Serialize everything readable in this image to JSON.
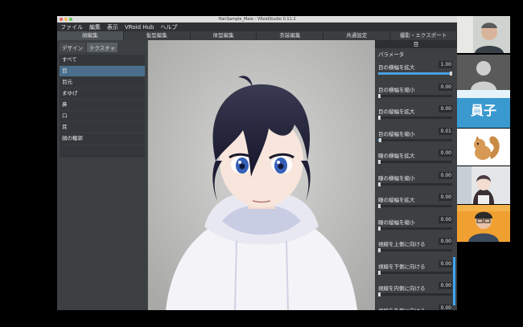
{
  "window": {
    "title": "HairSample_Male - VRoidStudio 0.11.2"
  },
  "menu": [
    "ファイル",
    "編集",
    "表示",
    "VRoid Hub",
    "ヘルプ"
  ],
  "main_tabs": [
    "顔編集",
    "髪型編集",
    "体型編集",
    "衣装編集",
    "共通設定",
    "撮影・エクスポート"
  ],
  "sub_tabs": [
    "デザイン",
    "テクスチャ"
  ],
  "categories": [
    "すべて",
    "目",
    "目元",
    "まゆげ",
    "鼻",
    "口",
    "耳",
    "顔の輪郭"
  ],
  "selected_category": "目",
  "panel": {
    "header": "目",
    "section_title": "パラメータ",
    "params": [
      {
        "label": "目の横幅を拡大",
        "value": "1.00",
        "level": 1.0
      },
      {
        "label": "目の横幅を縮小",
        "value": "0.00",
        "level": 0.0
      },
      {
        "label": "目の縦幅を拡大",
        "value": "0.00",
        "level": 0.0
      },
      {
        "label": "目の縦幅を縮小",
        "value": "0.01",
        "level": 0.01
      },
      {
        "label": "瞳の横幅を拡大",
        "value": "0.00",
        "level": 0.0
      },
      {
        "label": "瞳の横幅を縮小",
        "value": "0.00",
        "level": 0.0
      },
      {
        "label": "瞳の縦幅を拡大",
        "value": "0.00",
        "level": 0.0
      },
      {
        "label": "瞳の縦幅を縮小",
        "value": "0.00",
        "level": 0.0
      },
      {
        "label": "視線を上側に向ける",
        "value": "0.00",
        "level": 0.0
      },
      {
        "label": "視線を下側に向ける",
        "value": "0.00",
        "level": 0.0
      },
      {
        "label": "視線を内側に向ける",
        "value": "0.00",
        "level": 0.0
      },
      {
        "label": "視線を外側に向ける",
        "value": "0.00",
        "level": 0.0
      }
    ]
  },
  "video_tiles": {
    "tile2_text": "員子"
  },
  "colors": {
    "accent": "#3ea6ff",
    "selected": "#4a6e8c"
  }
}
